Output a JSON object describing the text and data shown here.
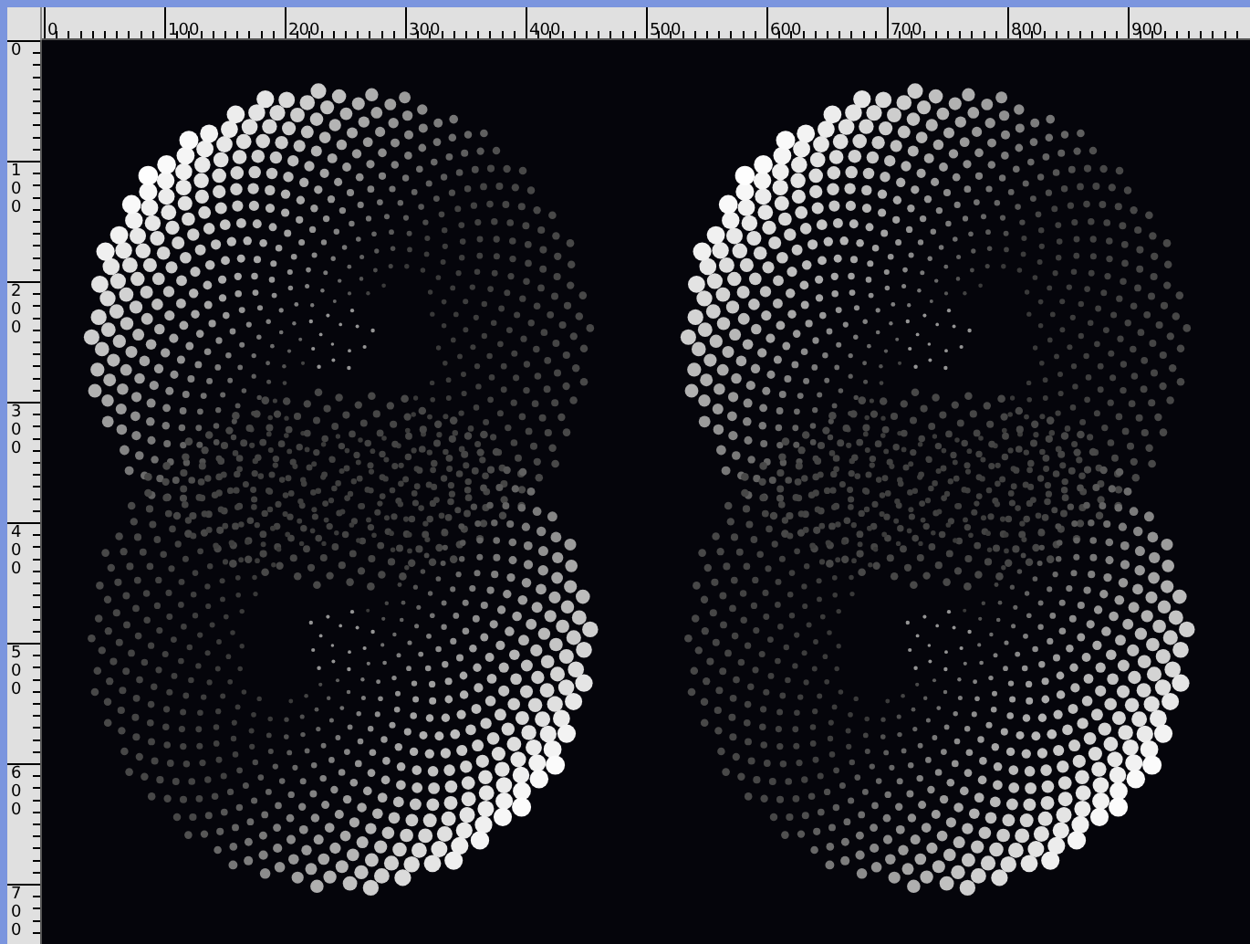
{
  "rulers": {
    "top": {
      "labels": [
        "0",
        "100",
        "200",
        "300",
        "400",
        "500",
        "600",
        "700",
        "800",
        "900"
      ]
    },
    "left": {
      "labels": [
        "0",
        "100",
        "200",
        "300",
        "400",
        "500",
        "600",
        "700"
      ]
    }
  }
}
